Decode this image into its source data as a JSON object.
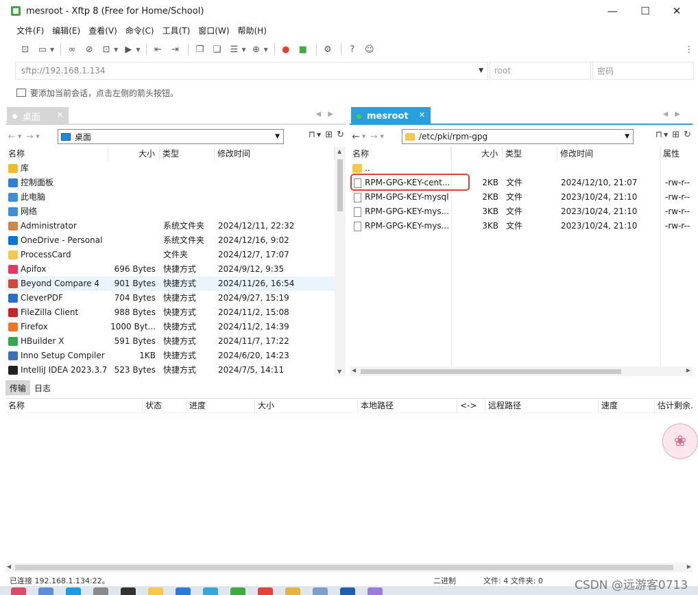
{
  "window": {
    "title": "mesroot - Xftp 8 (Free for Home/School)",
    "minimize": "—",
    "maximize": "☐",
    "close": "✕"
  },
  "menu": [
    "文件(F)",
    "编辑(E)",
    "查看(V)",
    "命令(C)",
    "工具(T)",
    "窗口(W)",
    "帮助(H)"
  ],
  "address": {
    "url": "sftp://192.168.1.134",
    "user_placeholder": "root",
    "password_placeholder": "密码"
  },
  "hint": "要添加当前会话，点击左侧的箭头按钮。",
  "left_pane": {
    "tab": "桌面",
    "path": "桌面",
    "columns": [
      "名称",
      "大小",
      "类型",
      "修改时间"
    ],
    "rows": [
      {
        "name": "库",
        "size": "",
        "type": "",
        "modified": "",
        "icon": "library-icon",
        "color": "#f5b82e"
      },
      {
        "name": "控制面板",
        "size": "",
        "type": "",
        "modified": "",
        "icon": "control-panel-icon",
        "color": "#2f7ed8"
      },
      {
        "name": "此电脑",
        "size": "",
        "type": "",
        "modified": "",
        "icon": "computer-icon",
        "color": "#3a8fd9"
      },
      {
        "name": "网络",
        "size": "",
        "type": "",
        "modified": "",
        "icon": "network-icon",
        "color": "#3a8fd9"
      },
      {
        "name": "Administrator",
        "size": "",
        "type": "系统文件夹",
        "modified": "2024/12/11, 22:32",
        "icon": "user-folder-icon",
        "color": "#c98a4a"
      },
      {
        "name": "OneDrive - Personal",
        "size": "",
        "type": "系统文件夹",
        "modified": "2024/12/16, 9:02",
        "icon": "onedrive-icon",
        "color": "#0a74d4"
      },
      {
        "name": "ProcessCard",
        "size": "",
        "type": "文件夹",
        "modified": "2024/12/7, 17:07",
        "icon": "folder-icon",
        "color": "#f5c84c"
      },
      {
        "name": "Apifox",
        "size": "696 Bytes",
        "type": "快捷方式",
        "modified": "2024/9/12, 9:35",
        "icon": "apifox-icon",
        "color": "#e8385f"
      },
      {
        "name": "Beyond Compare 4",
        "size": "901 Bytes",
        "type": "快捷方式",
        "modified": "2024/11/26, 16:54",
        "icon": "beyond-compare-icon",
        "color": "#d4463a"
      },
      {
        "name": "CleverPDF",
        "size": "704 Bytes",
        "type": "快捷方式",
        "modified": "2024/9/27, 15:19",
        "icon": "cleverpdf-icon",
        "color": "#2a6cc7"
      },
      {
        "name": "FileZilla Client",
        "size": "988 Bytes",
        "type": "快捷方式",
        "modified": "2024/11/2, 15:08",
        "icon": "filezilla-icon",
        "color": "#c9262b"
      },
      {
        "name": "Firefox",
        "size": "1000 Byt...",
        "type": "快捷方式",
        "modified": "2024/11/2, 14:39",
        "icon": "firefox-icon",
        "color": "#f07422"
      },
      {
        "name": "HBuilder X",
        "size": "591 Bytes",
        "type": "快捷方式",
        "modified": "2024/11/7, 17:22",
        "icon": "hbuilder-icon",
        "color": "#2fa94a"
      },
      {
        "name": "Inno Setup Compiler",
        "size": "1KB",
        "type": "快捷方式",
        "modified": "2024/6/20, 14:23",
        "icon": "inno-setup-icon",
        "color": "#3a6fb8"
      },
      {
        "name": "IntelliJ IDEA 2023.3.7",
        "size": "523 Bytes",
        "type": "快捷方式",
        "modified": "2024/7/5, 14:11",
        "icon": "intellij-icon",
        "color": "#222222"
      }
    ]
  },
  "right_pane": {
    "tab": "mesroot",
    "path": "/etc/pki/rpm-gpg",
    "columns": [
      "名称",
      "大小",
      "类型",
      "修改时间",
      "属性"
    ],
    "rows": [
      {
        "name": "..",
        "size": "",
        "type": "",
        "modified": "",
        "attr": "",
        "icon": "folder-icon"
      },
      {
        "name": "RPM-GPG-KEY-cent...",
        "size": "2KB",
        "type": "文件",
        "modified": "2024/12/10, 21:07",
        "attr": "-rw-r--",
        "icon": "file-icon"
      },
      {
        "name": "RPM-GPG-KEY-mysql",
        "size": "2KB",
        "type": "文件",
        "modified": "2023/10/24, 21:10",
        "attr": "-rw-r--",
        "icon": "file-icon"
      },
      {
        "name": "RPM-GPG-KEY-mys...",
        "size": "3KB",
        "type": "文件",
        "modified": "2023/10/24, 21:10",
        "attr": "-rw-r--",
        "icon": "file-icon"
      },
      {
        "name": "RPM-GPG-KEY-mys...",
        "size": "3KB",
        "type": "文件",
        "modified": "2023/10/24, 21:10",
        "attr": "-rw-r--",
        "icon": "file-icon"
      }
    ]
  },
  "transfer": {
    "tabs": [
      "传输",
      "日志"
    ],
    "columns": [
      "名称",
      "状态",
      "进度",
      "大小",
      "本地路径",
      "<->",
      "远程路径",
      "速度",
      "估计剩余..."
    ]
  },
  "status": {
    "left": "已连接 192.168.1.134:22。",
    "mode": "二进制",
    "counts": "文件: 4 文件夹: 0"
  },
  "watermark": "CSDN @远游客0713",
  "colors": {
    "accent": "#29a0de",
    "highlight": "#d9442b",
    "selected_row": "#e9f4fd"
  }
}
